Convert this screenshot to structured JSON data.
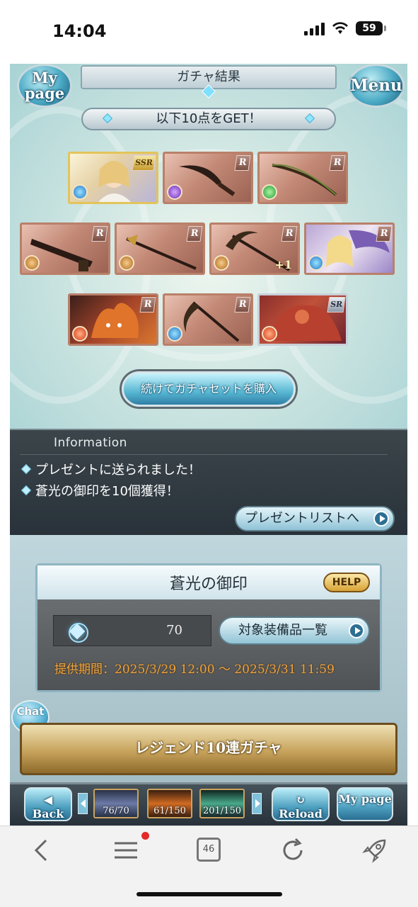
{
  "status_bar": {
    "time": "14:04",
    "battery": "59"
  },
  "header": {
    "mypage_label": "My page",
    "menu_label": "Menu",
    "title": "ガチャ結果"
  },
  "result": {
    "get_text": "以下10点をGET！",
    "cards": [
      {
        "rarity": "SSR",
        "element": "water",
        "kind": "character"
      },
      {
        "rarity": "R",
        "element": "dark",
        "kind": "weapon"
      },
      {
        "rarity": "R",
        "element": "wind",
        "kind": "weapon"
      },
      {
        "rarity": "R",
        "element": "earth",
        "kind": "weapon"
      },
      {
        "rarity": "R",
        "element": "earth",
        "kind": "weapon"
      },
      {
        "rarity": "R",
        "element": "earth",
        "kind": "weapon",
        "plus": "+1"
      },
      {
        "rarity": "R",
        "element": "water",
        "kind": "character"
      },
      {
        "rarity": "R",
        "element": "fire",
        "kind": "summon"
      },
      {
        "rarity": "R",
        "element": "water",
        "kind": "weapon"
      },
      {
        "rarity": "SR",
        "element": "fire",
        "kind": "summon"
      }
    ],
    "continue_button": "続けてガチャセットを購入"
  },
  "information": {
    "heading": "Information",
    "items": [
      "プレゼントに送られました！",
      "蒼光の御印を10個獲得！"
    ],
    "present_button": "プレゼントリストへ"
  },
  "seal": {
    "title": "蒼光の御印",
    "help": "HELP",
    "count": "70",
    "equip_button": "対象装備品一覧",
    "period": "提供期間：2025/3/29 12:00 〜 2025/3/31 11:59"
  },
  "chat_label": "Chat",
  "legend_banner": "レジェンド10連ガチャ",
  "bottom_nav": {
    "back": "Back",
    "resources": [
      "76/70",
      "61/150",
      "201/150"
    ],
    "reload": "Reload",
    "mypage": "My page"
  },
  "browser": {
    "tab_count": "46"
  },
  "colors": {
    "accent_blue": "#4aa9c4",
    "period_orange": "#f0a540",
    "legend_gold": "#c7a35c"
  }
}
